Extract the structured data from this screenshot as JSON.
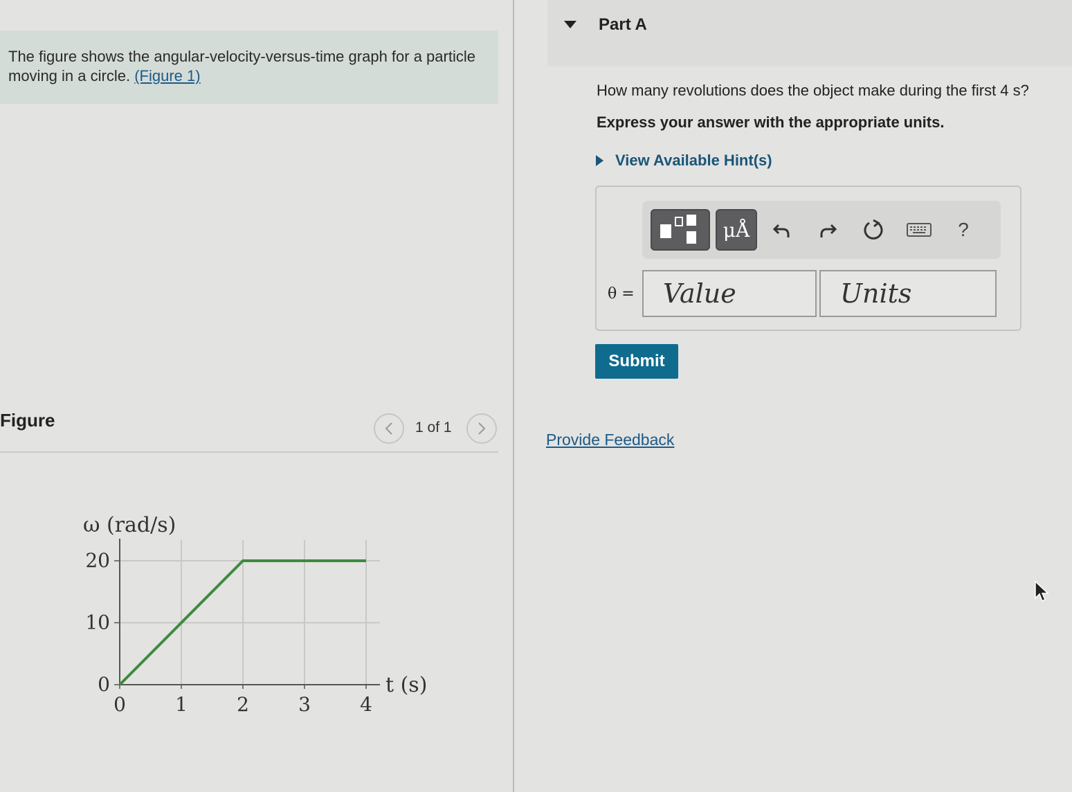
{
  "intro": {
    "text": "The figure shows the angular-velocity-versus-time graph for a particle moving in a circle.",
    "figure_link": "(Figure 1)"
  },
  "figure": {
    "heading": "Figure",
    "pager": "1 of 1",
    "prev_icon": "chevron-left-icon",
    "next_icon": "chevron-right-icon"
  },
  "chart_data": {
    "type": "line",
    "x": [
      0,
      2,
      4
    ],
    "series": [
      {
        "values": [
          0,
          20,
          20
        ]
      }
    ],
    "ylabel": "ω (rad/s)",
    "xlabel": "t (s)",
    "xticks": [
      "0",
      "1",
      "2",
      "3",
      "4"
    ],
    "yticks": [
      "0",
      "10",
      "20"
    ],
    "xlim": [
      0,
      4
    ],
    "ylim": [
      0,
      20
    ],
    "grid": true,
    "line_color": "#3e8a3e"
  },
  "part": {
    "title": "Part A",
    "question": "How many revolutions does the object make during the first 4 s?",
    "instruction": "Express your answer with the appropriate units.",
    "hint_label": "View Available Hint(s)"
  },
  "toolbar": {
    "units_label": "μÅ",
    "help_label": "?",
    "icons": [
      "templates-icon",
      "units-icon",
      "undo-icon",
      "redo-icon",
      "reset-icon",
      "keyboard-icon",
      "help-icon"
    ]
  },
  "answer": {
    "variable_label": "θ =",
    "value_placeholder": "Value",
    "units_placeholder": "Units"
  },
  "submit_label": "Submit",
  "feedback_label": "Provide Feedback",
  "colors": {
    "accent": "#0f6c8f",
    "link": "#1d5a87",
    "intro_bg": "#d4dcd8",
    "background": "#e3e3e1"
  }
}
